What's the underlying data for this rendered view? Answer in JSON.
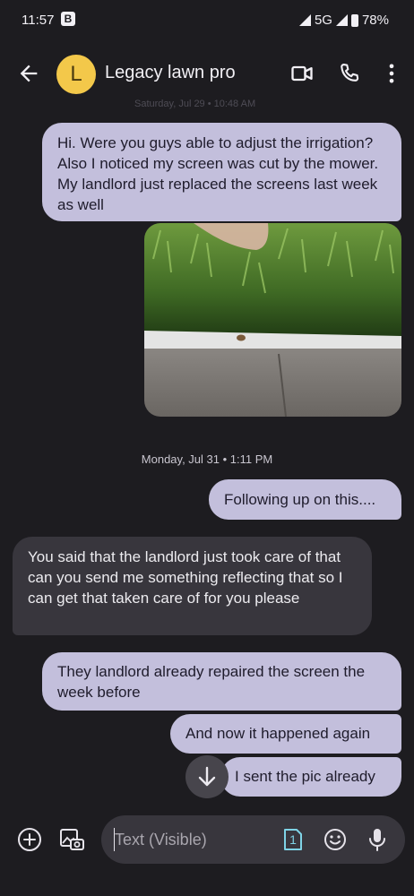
{
  "status_bar": {
    "time": "11:57",
    "badge": "B",
    "network": "5G",
    "battery": "78%"
  },
  "header": {
    "avatar_letter": "L",
    "contact_name": "Legacy lawn pro"
  },
  "ghost_timestamp": "Saturday, Jul 29 • 10:48 AM",
  "messages": [
    {
      "direction": "outgoing",
      "text": "Hi. Were you guys able to adjust the irrigation? Also I noticed my screen was cut by the mower. My landlord just replaced the screens last week as well"
    },
    {
      "direction": "outgoing",
      "type": "image"
    },
    {
      "direction": "outgoing",
      "text": "Following up on this...."
    },
    {
      "direction": "incoming",
      "text": "You said that the landlord just took care of that can you send me something reflecting that so I can get that taken care of for you please"
    },
    {
      "direction": "outgoing",
      "text": "They landlord already repaired the screen the week before"
    },
    {
      "direction": "outgoing",
      "text": "And now it happened again"
    },
    {
      "direction": "outgoing",
      "text": "I sent the pic already"
    }
  ],
  "date_divider": "Monday, Jul 31 • 1:11 PM",
  "composer": {
    "placeholder": "Text (Visible)",
    "sim_number": "1"
  },
  "colors": {
    "background": "#1d1c20",
    "outgoing_bubble": "#c3bfdc",
    "incoming_bubble": "#38363d",
    "avatar": "#f3c84a"
  }
}
